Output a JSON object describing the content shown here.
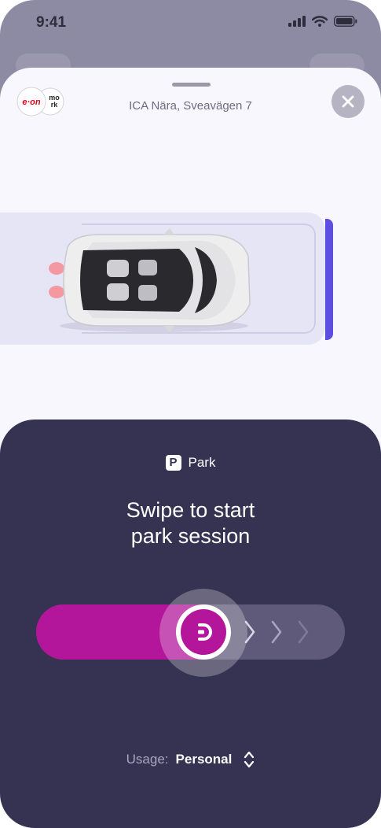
{
  "status_bar": {
    "time": "9:41"
  },
  "header": {
    "logo_text_1": "e·on",
    "logo_text_2": "mo",
    "logo_text_3": "rk",
    "location": "ICA Nära, Sveavägen 7"
  },
  "park": {
    "mode_label": "Park",
    "headline_line1": "Swipe to start",
    "headline_line2": "park session"
  },
  "slider": {
    "progress": 0.55
  },
  "usage": {
    "label": "Usage:",
    "value": "Personal"
  },
  "colors": {
    "accent": "#b3169b",
    "panel": "#363252",
    "stall_indicator": "#5b4ee0",
    "eon_red": "#e3001b"
  }
}
